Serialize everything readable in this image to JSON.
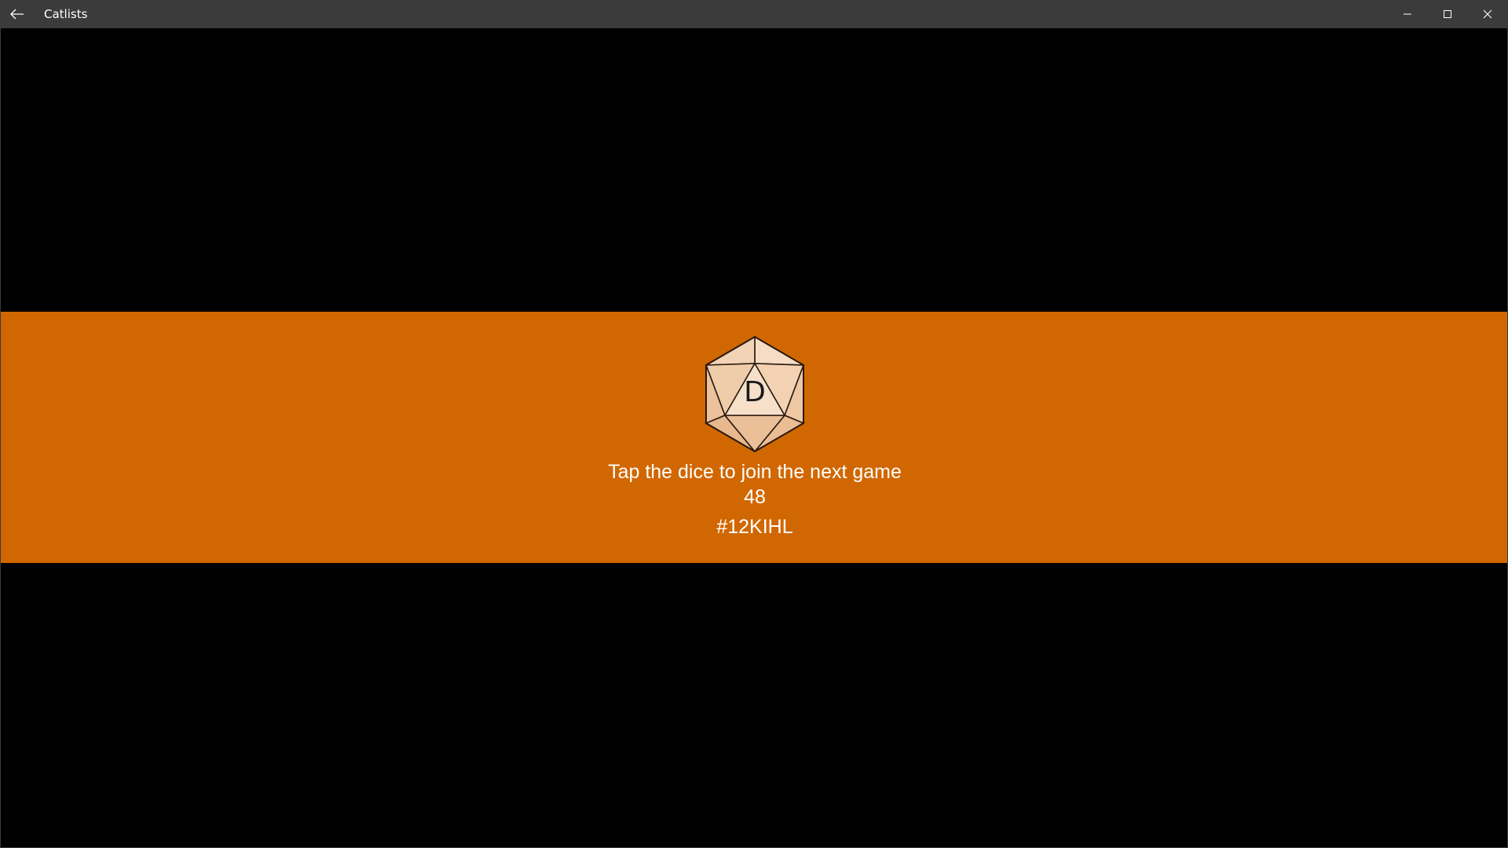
{
  "window": {
    "title": "Catlists"
  },
  "colors": {
    "titlebar": "#3b3b3b",
    "band": "#d16700",
    "background": "#000000",
    "dice_face_light": "#f6dcc4",
    "dice_face_mid": "#efc9a6",
    "dice_face_dark": "#e8b88e"
  },
  "icons": {
    "back": "arrow-left-icon",
    "minimize": "minimize-icon",
    "maximize": "maximize-icon",
    "close": "close-icon",
    "dice": "d20-icosahedron-icon"
  },
  "game": {
    "dice_letter": "D",
    "instruction": "Tap the dice to join the next game",
    "countdown": "48",
    "code": "#12KIHL"
  }
}
